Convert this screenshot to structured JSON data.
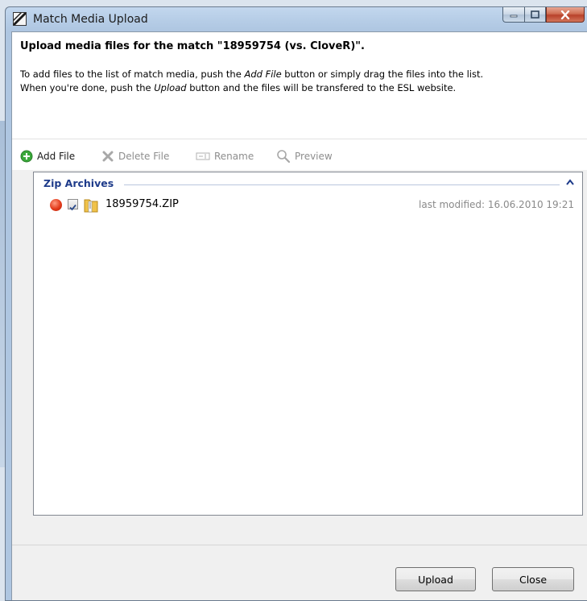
{
  "window": {
    "title": "Match Media Upload",
    "app_icon": "esl-logo-icon",
    "controls": [
      "minimize-icon",
      "maximize-icon",
      "close-icon"
    ]
  },
  "header": {
    "heading": "Upload media files for the match \"18959754 (vs. CloveR)\".",
    "desc_line1": [
      "To add files to the list of match media, push the ",
      "Add File",
      " button or simply drag the files into the list."
    ],
    "desc_line2": [
      "When you're done, push the ",
      "Upload",
      " button and the files will be transfered to the ESL website."
    ]
  },
  "toolbar": {
    "add_file": "Add File",
    "delete_file": "Delete File",
    "rename": "Rename",
    "preview": "Preview"
  },
  "list": {
    "group_title": "Zip Archives",
    "items": [
      {
        "status": "red",
        "checked": true,
        "filename": "18959754.ZIP",
        "modified": "last modified: 16.06.2010 19:21"
      }
    ]
  },
  "footer": {
    "upload_label": "Upload",
    "close_label": "Close"
  },
  "colors": {
    "group_title": "#1e3b8a",
    "status_red": "#e23a1a",
    "add_green": "#3aa83a"
  }
}
